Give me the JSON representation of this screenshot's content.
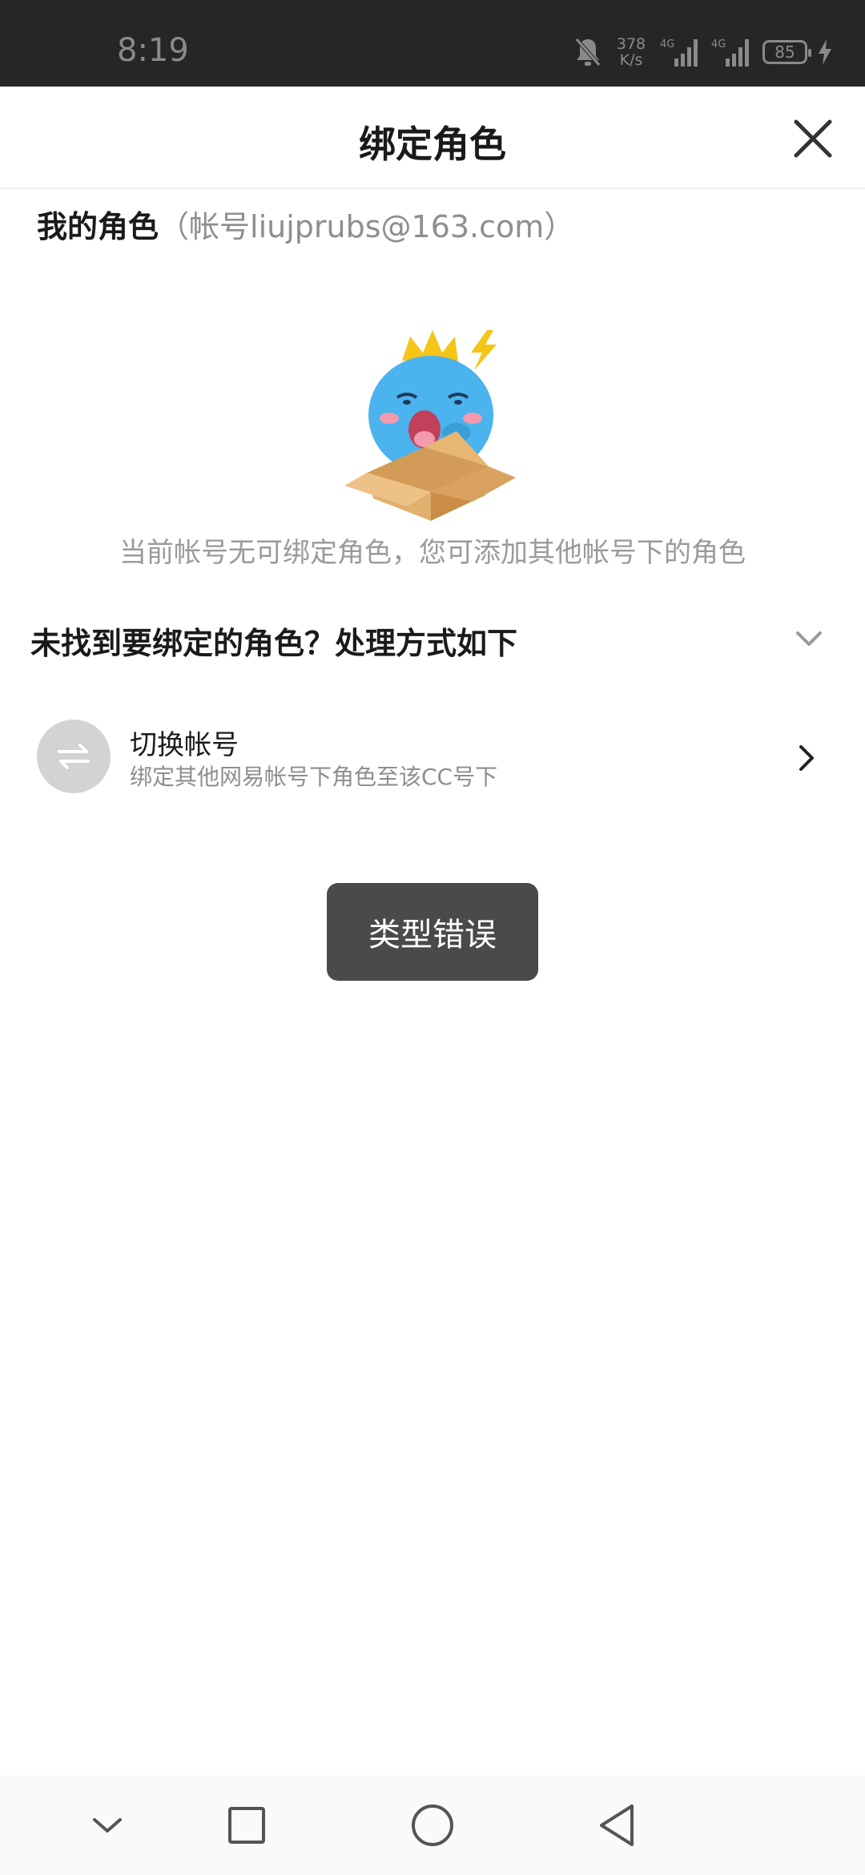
{
  "status_bar": {
    "time": "8:19",
    "net_speed_value": "378",
    "net_speed_unit": "K/s",
    "signal_1_label": "4G",
    "signal_2_label": "4G",
    "battery_level": "85",
    "icons": [
      "bell-off-icon",
      "signal-icon",
      "signal-icon",
      "battery-icon",
      "charging-icon"
    ]
  },
  "header": {
    "title": "绑定角色",
    "close_icon": "close-icon"
  },
  "my_roles": {
    "label": "我的角色",
    "account_text": "（帐号liujprubs@163.com）"
  },
  "empty_state": {
    "illustration": "empty-box-mascot",
    "message": "当前帐号无可绑定角色，您可添加其他帐号下的角色"
  },
  "help_section": {
    "title": "未找到要绑定的角色？处理方式如下",
    "expand_icon": "chevron-down-icon"
  },
  "switch_account": {
    "title": "切换帐号",
    "subtitle": "绑定其他网易帐号下角色至该CC号下",
    "icon": "swap-icon",
    "arrow_icon": "chevron-right-icon"
  },
  "toast": {
    "message": "类型错误"
  },
  "nav_bar": {
    "buttons": [
      "chevron-down-icon",
      "square-icon",
      "circle-icon",
      "triangle-back-icon"
    ]
  },
  "colors": {
    "status_bar_bg": "#262626",
    "toast_bg": "#4a4a4a",
    "mascot_blue": "#4bb3ee",
    "crown_yellow": "#f5c518",
    "box_tan": "#e2b06e"
  }
}
